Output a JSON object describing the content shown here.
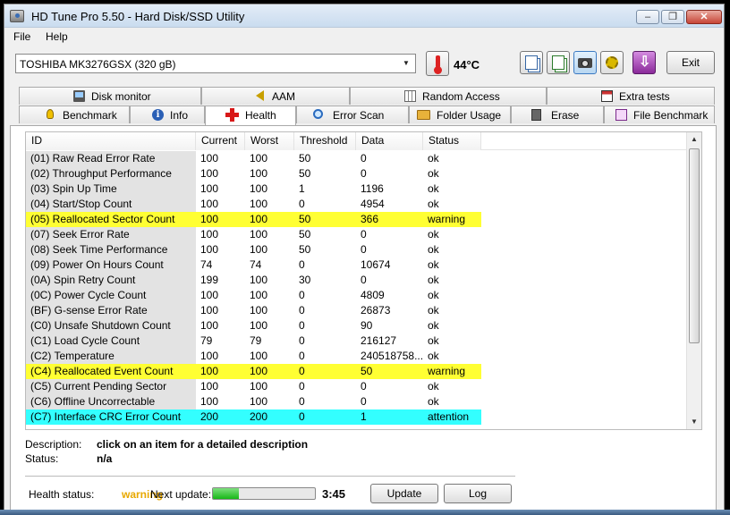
{
  "window": {
    "title": "HD Tune Pro 5.50 - Hard Disk/SSD Utility"
  },
  "menu": {
    "file": "File",
    "help": "Help"
  },
  "toolbar": {
    "drive": "TOSHIBA MK3276GSX (320 gB)",
    "temperature": "44°C",
    "exit_label": "Exit",
    "icons": [
      "copy-text-icon",
      "copy-screenshot-icon",
      "camera-icon",
      "options-gear-icon",
      "save-down-icon"
    ]
  },
  "tabs": {
    "top": [
      "Disk monitor",
      "AAM",
      "Random Access",
      "Extra tests"
    ],
    "bottom": [
      "Benchmark",
      "Info",
      "Health",
      "Error Scan",
      "Folder Usage",
      "Erase",
      "File Benchmark"
    ],
    "active": "Health"
  },
  "table": {
    "columns": [
      "ID",
      "Current",
      "Worst",
      "Threshold",
      "Data",
      "Status"
    ],
    "rows": [
      {
        "id": "(01) Raw Read Error Rate",
        "current": "100",
        "worst": "100",
        "threshold": "50",
        "data": "0",
        "status": "ok",
        "highlight": ""
      },
      {
        "id": "(02) Throughput Performance",
        "current": "100",
        "worst": "100",
        "threshold": "50",
        "data": "0",
        "status": "ok",
        "highlight": ""
      },
      {
        "id": "(03) Spin Up Time",
        "current": "100",
        "worst": "100",
        "threshold": "1",
        "data": "1196",
        "status": "ok",
        "highlight": ""
      },
      {
        "id": "(04) Start/Stop Count",
        "current": "100",
        "worst": "100",
        "threshold": "0",
        "data": "4954",
        "status": "ok",
        "highlight": ""
      },
      {
        "id": "(05) Reallocated Sector Count",
        "current": "100",
        "worst": "100",
        "threshold": "50",
        "data": "366",
        "status": "warning",
        "highlight": "yellow"
      },
      {
        "id": "(07) Seek Error Rate",
        "current": "100",
        "worst": "100",
        "threshold": "50",
        "data": "0",
        "status": "ok",
        "highlight": ""
      },
      {
        "id": "(08) Seek Time Performance",
        "current": "100",
        "worst": "100",
        "threshold": "50",
        "data": "0",
        "status": "ok",
        "highlight": ""
      },
      {
        "id": "(09) Power On Hours Count",
        "current": "74",
        "worst": "74",
        "threshold": "0",
        "data": "10674",
        "status": "ok",
        "highlight": ""
      },
      {
        "id": "(0A) Spin Retry Count",
        "current": "199",
        "worst": "100",
        "threshold": "30",
        "data": "0",
        "status": "ok",
        "highlight": ""
      },
      {
        "id": "(0C) Power Cycle Count",
        "current": "100",
        "worst": "100",
        "threshold": "0",
        "data": "4809",
        "status": "ok",
        "highlight": ""
      },
      {
        "id": "(BF) G-sense Error Rate",
        "current": "100",
        "worst": "100",
        "threshold": "0",
        "data": "26873",
        "status": "ok",
        "highlight": ""
      },
      {
        "id": "(C0) Unsafe Shutdown Count",
        "current": "100",
        "worst": "100",
        "threshold": "0",
        "data": "90",
        "status": "ok",
        "highlight": ""
      },
      {
        "id": "(C1) Load Cycle Count",
        "current": "79",
        "worst": "79",
        "threshold": "0",
        "data": "216127",
        "status": "ok",
        "highlight": ""
      },
      {
        "id": "(C2) Temperature",
        "current": "100",
        "worst": "100",
        "threshold": "0",
        "data": "240518758...",
        "status": "ok",
        "highlight": ""
      },
      {
        "id": "(C4) Reallocated Event Count",
        "current": "100",
        "worst": "100",
        "threshold": "0",
        "data": "50",
        "status": "warning",
        "highlight": "yellow"
      },
      {
        "id": "(C5) Current Pending Sector",
        "current": "100",
        "worst": "100",
        "threshold": "0",
        "data": "0",
        "status": "ok",
        "highlight": ""
      },
      {
        "id": "(C6) Offline Uncorrectable",
        "current": "100",
        "worst": "100",
        "threshold": "0",
        "data": "0",
        "status": "ok",
        "highlight": ""
      },
      {
        "id": "(C7) Interface CRC Error Count",
        "current": "200",
        "worst": "200",
        "threshold": "0",
        "data": "1",
        "status": "attention",
        "highlight": "cyan"
      }
    ]
  },
  "description": {
    "desc_label": "Description:",
    "desc_value": "click on an item for a detailed description",
    "status_label": "Status:",
    "status_value": "n/a"
  },
  "status_bar": {
    "health_label": "Health status:",
    "health_value": "warning",
    "next_update_label": "Next update:",
    "next_update_progress": 0.25,
    "next_update_time": "3:45",
    "update_button": "Update",
    "log_button": "Log"
  }
}
